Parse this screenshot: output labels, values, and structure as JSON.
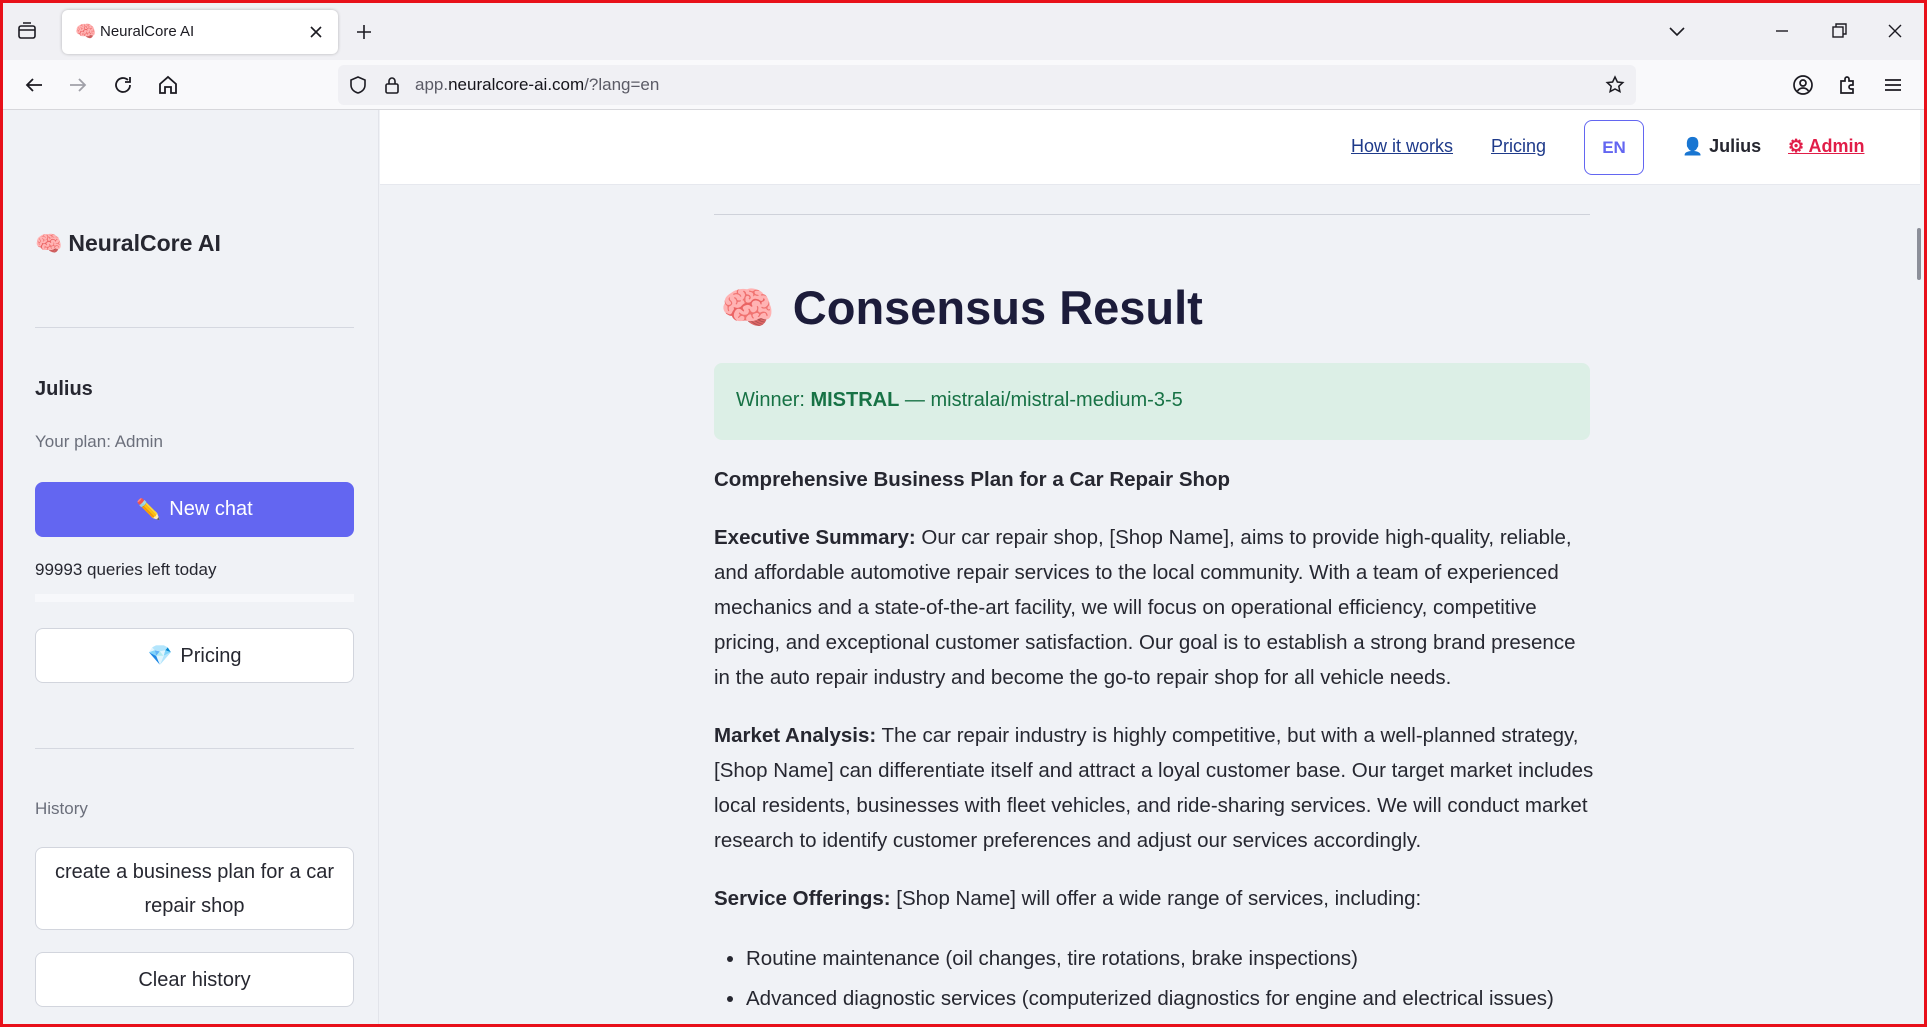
{
  "browser": {
    "tab": {
      "favicon": "🧠",
      "title": "NeuralCore AI"
    },
    "url": {
      "prefix": "app.",
      "host": "neuralcore-ai.com",
      "path": "/?lang=en"
    },
    "icons": {
      "tab_list": "tab-list-icon",
      "close_tab": "close-icon",
      "new_tab": "plus-icon",
      "list_all_tabs": "chevron-down-icon",
      "minimize": "minimize-icon",
      "restore": "restore-icon",
      "close_window": "close-icon",
      "back": "arrow-left-icon",
      "forward": "arrow-right-icon",
      "reload": "reload-icon",
      "home": "home-icon",
      "tracking_protection": "shield-icon",
      "lock": "lock-icon",
      "bookmark": "star-icon",
      "account": "account-icon",
      "extensions": "puzzle-icon",
      "menu": "hamburger-icon"
    }
  },
  "sidebar": {
    "brand_emoji": "🧠",
    "brand": "NeuralCore AI",
    "user_name": "Julius",
    "plan": "Your plan: Admin",
    "new_chat_emoji": "✏️",
    "new_chat": "New chat",
    "queries_left": "99993 queries left today",
    "pricing_emoji": "💎",
    "pricing": "Pricing",
    "history_label": "History",
    "history_items": [
      "create a business plan for a car repair shop"
    ],
    "clear_history": "Clear history"
  },
  "header": {
    "how_it_works": "How it works",
    "pricing": "Pricing",
    "lang": "EN",
    "user_emoji": "👤",
    "user": "Julius",
    "admin": "⚙ Admin"
  },
  "main": {
    "title_emoji": "🧠",
    "title": "Consensus Result",
    "winner_label": "Winner: ",
    "winner_name": "MISTRAL",
    "winner_model": " — mistralai/mistral-medium-3-5",
    "doc_title": "Comprehensive Business Plan for a Car Repair Shop",
    "sections": [
      {
        "heading": "Executive Summary:",
        "text": " Our car repair shop, [Shop Name], aims to provide high-quality, reliable, and affordable automotive repair services to the local community. With a team of experienced mechanics and a state-of-the-art facility, we will focus on operational efficiency, competitive pricing, and exceptional customer satisfaction. Our goal is to establish a strong brand presence in the auto repair industry and become the go-to repair shop for all vehicle needs."
      },
      {
        "heading": "Market Analysis:",
        "text": " The car repair industry is highly competitive, but with a well-planned strategy, [Shop Name] can differentiate itself and attract a loyal customer base. Our target market includes local residents, businesses with fleet vehicles, and ride-sharing services. We will conduct market research to identify customer preferences and adjust our services accordingly."
      },
      {
        "heading": "Service Offerings:",
        "text": " [Shop Name] will offer a wide range of services, including:"
      }
    ],
    "services": [
      "Routine maintenance (oil changes, tire rotations, brake inspections)",
      "Advanced diagnostic services (computerized diagnostics for engine and electrical issues)"
    ]
  }
}
